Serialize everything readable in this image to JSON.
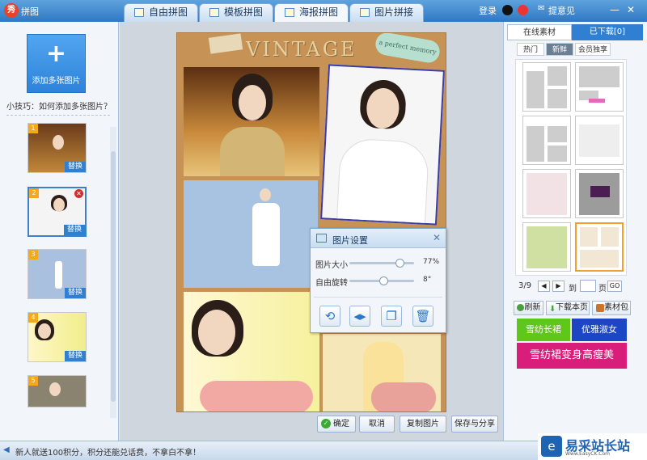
{
  "app": {
    "title": "拼图"
  },
  "tabs": [
    {
      "label": "自由拼图"
    },
    {
      "label": "模板拼图"
    },
    {
      "label": "海报拼图"
    },
    {
      "label": "图片拼接"
    }
  ],
  "header": {
    "login": "登录",
    "feedback": "提意见",
    "minimize": "—",
    "close": "✕"
  },
  "left": {
    "add_plus": "+",
    "add_label": "添加多张图片",
    "tip": "小技巧：如何添加多张图片？",
    "thumbs": [
      {
        "num": "1",
        "replace": "替换"
      },
      {
        "num": "2",
        "replace": "替换"
      },
      {
        "num": "3",
        "replace": "替换"
      },
      {
        "num": "4",
        "replace": "替换"
      },
      {
        "num": "5"
      }
    ]
  },
  "poster": {
    "title": "VINTAGE",
    "sticker": "a perfect memory"
  },
  "dialog": {
    "title": "图片设置",
    "size_label": "图片大小",
    "size_value": "77%",
    "rotate_label": "自由旋转",
    "rotate_value": "8°",
    "sliders": {
      "size_level": 0.77,
      "rotate_level": 0.53
    }
  },
  "bottom": {
    "confirm": "确定",
    "cancel": "取消",
    "copy": "复制图片",
    "save": "保存与分享"
  },
  "right": {
    "tab_online": "在线素材",
    "tab_downloaded": "已下载[0]",
    "sub_hot": "热门",
    "sub_new": "新鲜",
    "sub_member": "会员独享",
    "page": "3/9",
    "prev": "◀",
    "next": "▶",
    "to": "到",
    "page_unit": "页",
    "go": "GO",
    "refresh": "刷新",
    "download_page": "下载本页",
    "material_pack": "素材包",
    "ad1": "雪纺长裙",
    "ad2": "优雅淑女",
    "ad3": "雪纺裙变身高瘦美"
  },
  "status": {
    "text": "新人就送100积分，积分还能兑话费，不拿白不拿！"
  },
  "watermark": {
    "name": "易采站长站",
    "url": "Www.EasyCK.Com"
  },
  "colors": {
    "accent": "#2f80d2",
    "ad_green": "#5fc61a",
    "ad_blue": "#1c46c4",
    "ad_pink": "#d81e7a"
  }
}
